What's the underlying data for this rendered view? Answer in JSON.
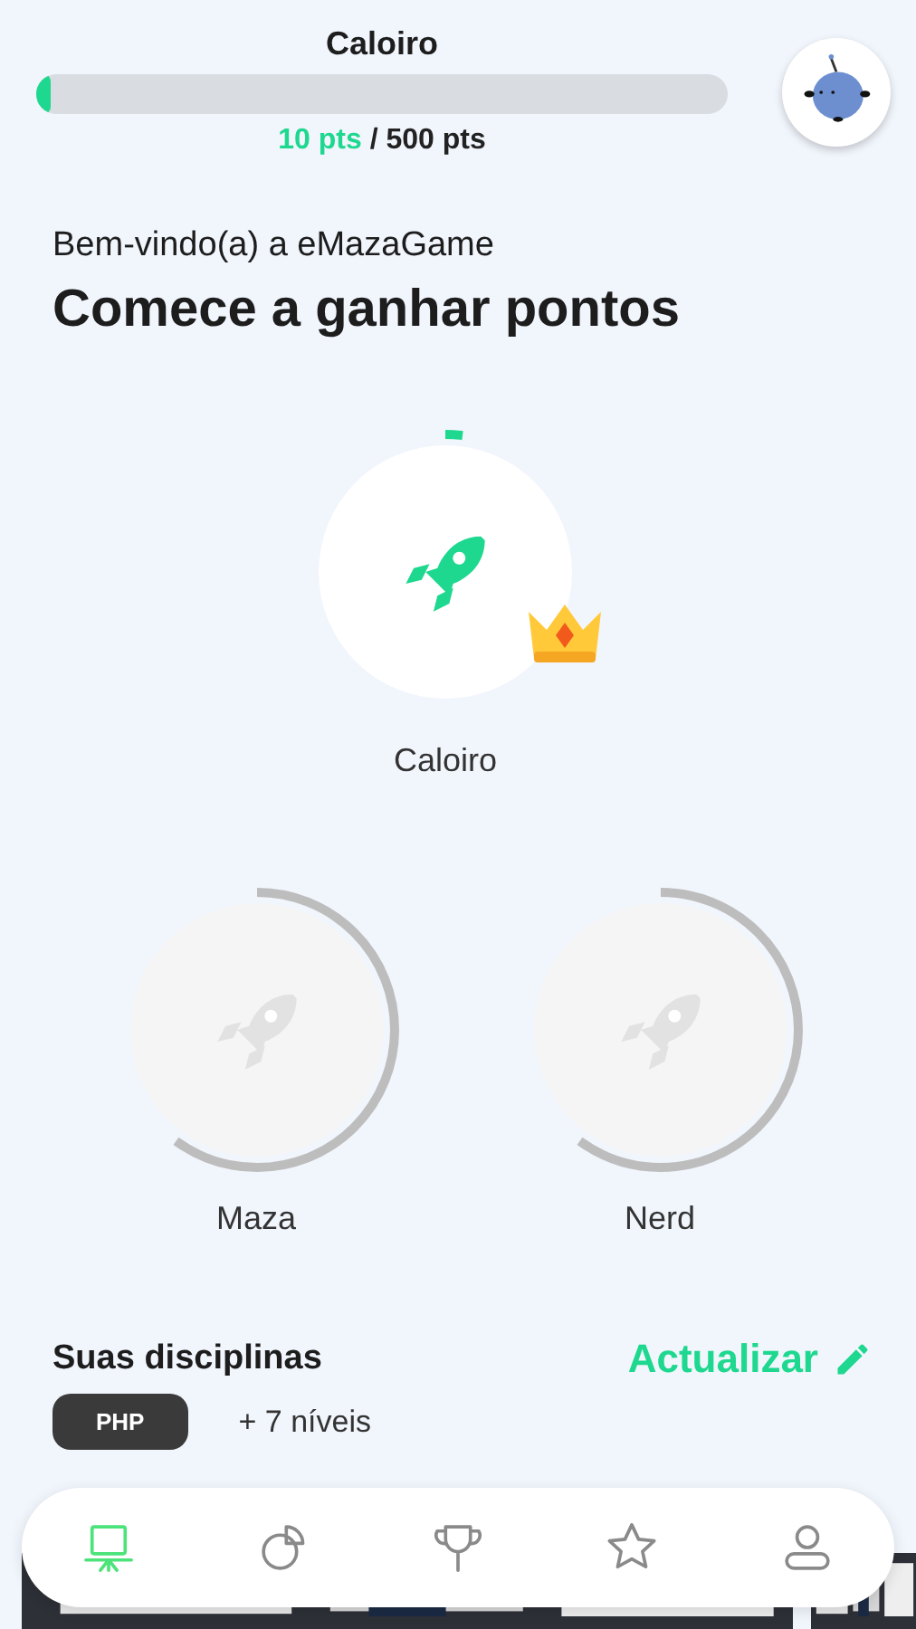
{
  "header": {
    "rank": "Caloiro",
    "level": 0.02,
    "points": "10 pts",
    "total": " / 500 pts"
  },
  "welcome": "Bem-vindo(a) a eMazaGame",
  "heading": "Comece a ganhar pontos",
  "levels": [
    {
      "name": "Caloiro",
      "locked": false,
      "current": true,
      "level": 0.02
    },
    {
      "name": "Maza",
      "locked": true,
      "current": false,
      "level": 0.6
    },
    {
      "name": "Nerd",
      "locked": true,
      "current": false,
      "level": 0.6
    }
  ],
  "disciplines": {
    "title": "Suas disciplinas",
    "action": "Actualizar",
    "tags": [
      "PHP"
    ],
    "more": "+ 7 níveis",
    "cards": [
      {
        "kind": "picture"
      },
      {
        "kind": "picture"
      }
    ]
  },
  "nav": [
    {
      "kind": "board",
      "selected": true
    },
    {
      "kind": "chart",
      "selected": false
    },
    {
      "kind": "trophy",
      "selected": false
    },
    {
      "kind": "star",
      "selected": false
    },
    {
      "kind": "profile",
      "selected": false
    }
  ]
}
